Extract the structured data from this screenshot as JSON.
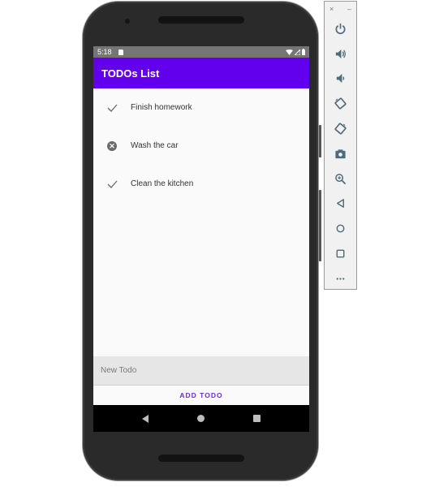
{
  "status_bar": {
    "time": "5:18",
    "icons": [
      "sd-card-icon",
      "wifi-icon",
      "signal-icon",
      "battery-icon"
    ]
  },
  "app_bar": {
    "title": "TODOs List"
  },
  "todos": [
    {
      "label": "Finish homework",
      "status": "done",
      "icon": "check-icon"
    },
    {
      "label": "Wash the car",
      "status": "not-done",
      "icon": "cancel-circle-icon"
    },
    {
      "label": "Clean the kitchen",
      "status": "done",
      "icon": "check-icon"
    }
  ],
  "new_todo": {
    "value": "",
    "placeholder": "New Todo"
  },
  "add_button": {
    "label": "ADD TODO",
    "color": "#6f2bd8"
  },
  "nav_bar": {
    "buttons": [
      "back",
      "home",
      "recents"
    ]
  },
  "emulator_toolbar": {
    "window_controls": {
      "close": "×",
      "minimize": "–"
    },
    "buttons": [
      "power",
      "volume-up",
      "volume-down",
      "rotate-left",
      "rotate-right",
      "screenshot",
      "zoom",
      "back",
      "home",
      "overview",
      "more"
    ]
  },
  "colors": {
    "primary": "#6200ee",
    "status_bar": "#757575"
  }
}
